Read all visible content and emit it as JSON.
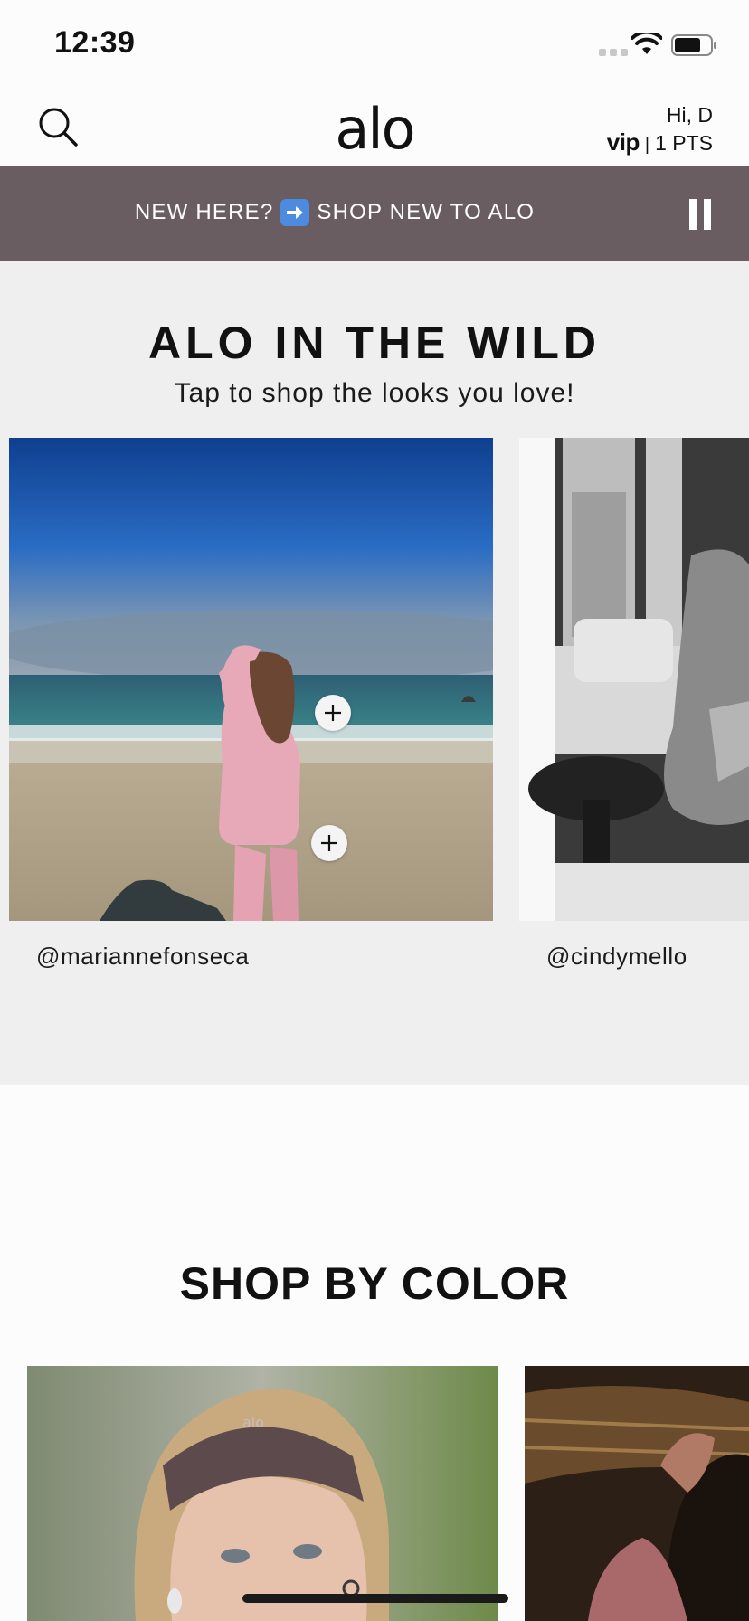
{
  "status_bar": {
    "time": "12:39"
  },
  "header": {
    "logo": "alo",
    "greeting": "Hi, D",
    "vip_label": "vip",
    "separator": "|",
    "points": "1 PTS"
  },
  "promo_banner": {
    "text_before": "NEW HERE?",
    "arrow_icon": "right-arrow-emoji",
    "text_after": "SHOP NEW TO ALO",
    "arrow_color": "#4d8be0",
    "background": "#6a5d62"
  },
  "wild_section": {
    "title": "ALO IN THE WILD",
    "subtitle": "Tap to shop the looks you love!",
    "cards": [
      {
        "handle": "@mariannefonseca"
      },
      {
        "handle": "@cindymello"
      }
    ]
  },
  "color_section": {
    "title": "SHOP BY COLOR",
    "headband_logo": "alo"
  }
}
